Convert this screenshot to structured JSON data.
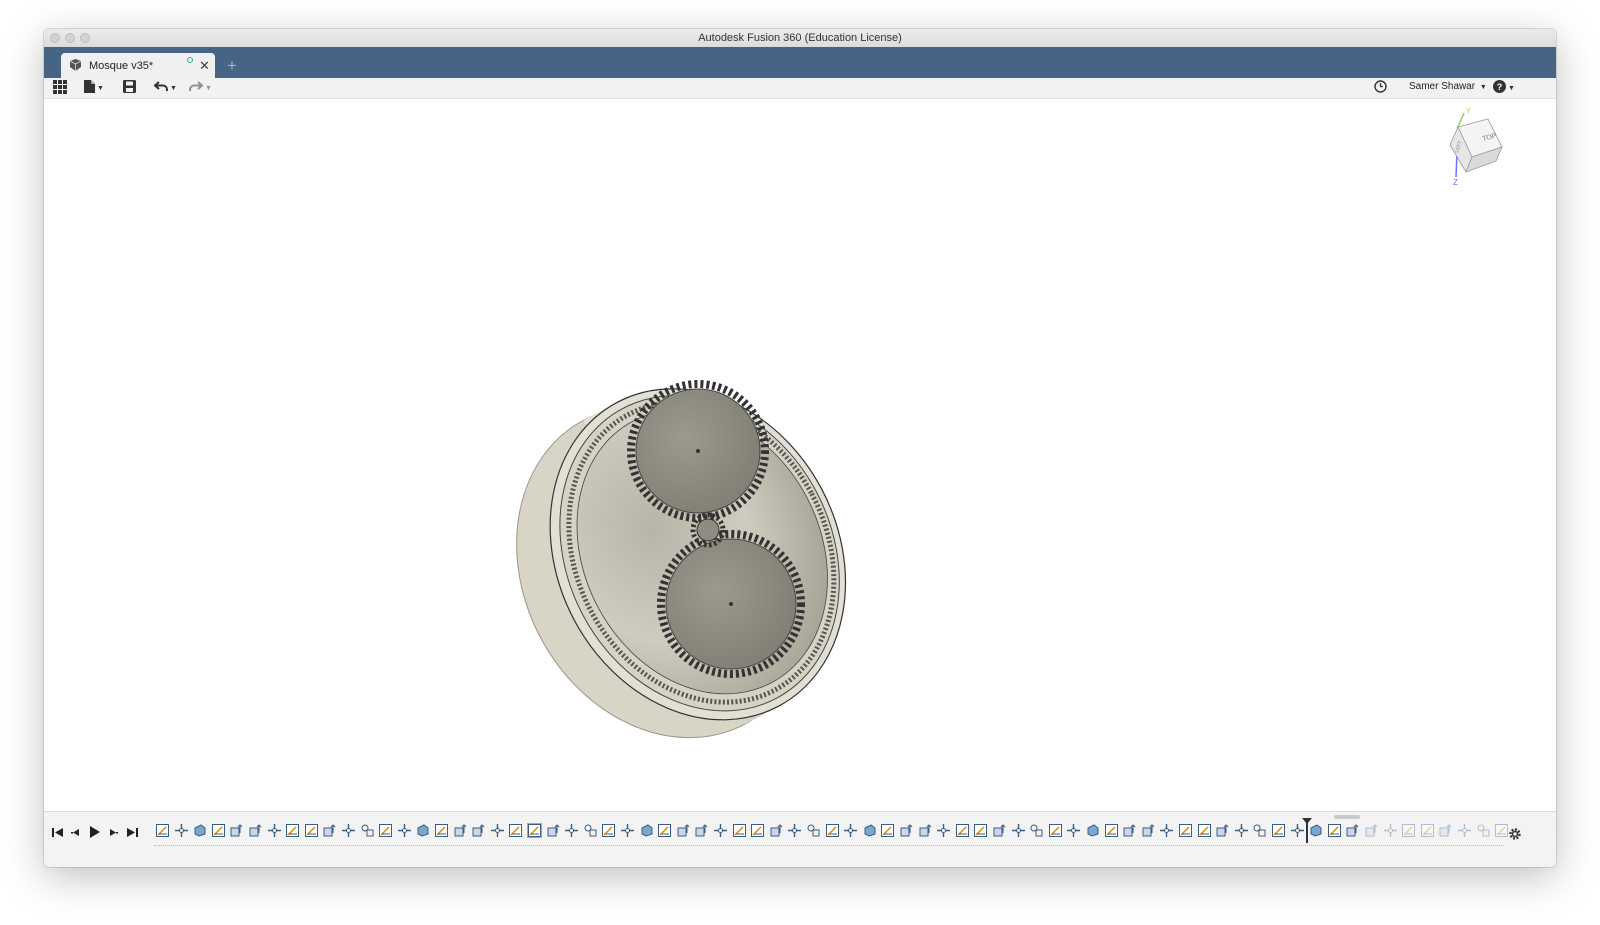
{
  "window": {
    "title": "Autodesk Fusion 360 (Education License)"
  },
  "tabs": [
    {
      "label": "Mosque v35*",
      "close": "✕"
    }
  ],
  "new_tab_label": "+",
  "toolbar": {
    "user_name": "Samer Shawar"
  },
  "model": {
    "description": "gear assembly"
  },
  "viewcube": {
    "face_top": "TOP",
    "face_side": "LEFT",
    "axis_y": "Y",
    "axis_z": "Z"
  },
  "timeline": {
    "feature_count": 73,
    "current_index": 64,
    "highlighted_index": 20
  },
  "colors": {
    "tab_strip": "#466585",
    "model_body": "#d9d6c8",
    "gear": "#8e8b80",
    "highlight": "#f2e400"
  }
}
